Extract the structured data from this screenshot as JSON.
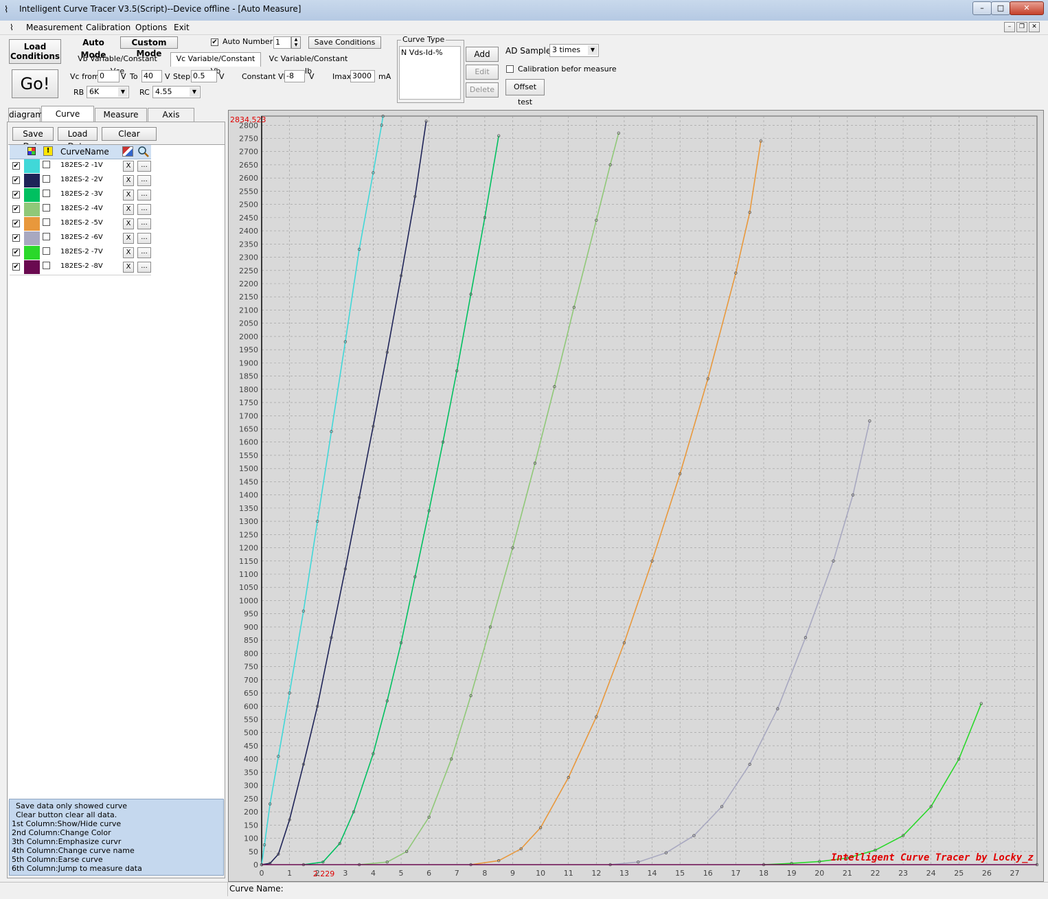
{
  "window": {
    "title": "Intelligent Curve Tracer V3.5(Script)--Device offline - [Auto Measure]",
    "min": "–",
    "max": "□",
    "close": "✕",
    "mdi_min": "–",
    "mdi_restore": "❐",
    "mdi_close": "✕"
  },
  "menu": {
    "items": [
      "Measurement",
      "Calibration",
      "Options",
      "Exit"
    ]
  },
  "toolbar": {
    "load_conditions": "Load Conditions",
    "go": "Go!",
    "auto_mode": "Auto Mode",
    "custom_mode": "Custom Mode",
    "auto_number_label": "Auto Number",
    "auto_number_value": "1",
    "auto_number_checked": "✔",
    "save_conditions": "Save Conditions",
    "mode_tabs": [
      "Vb Variable/Constant Vce",
      "Vc Variable/Constant Vb",
      "Vc Variable/Constant Ib"
    ],
    "vc_from_label": "Vc from",
    "vc_from": "0",
    "v1": "V",
    "to_label": "To",
    "to": "40",
    "v2": "V",
    "step_label": "Step",
    "step": "0.5",
    "v3": "V",
    "constant_vb_label": "Constant Vb",
    "constant_vb": "-8",
    "v4": "V",
    "imax_label": "Imax",
    "imax": "3000",
    "ma": "mA",
    "rb_label": "RB",
    "rb": "6K",
    "rc_label": "RC",
    "rc": "4.55",
    "curve_type_label": "Curve Type",
    "curve_type_item": "N Vds-Id-%",
    "add": "Add",
    "edit": "Edit",
    "delete": "Delete",
    "ad_sample_label": "AD Sample",
    "ad_sample": "3 times",
    "calibration_label": "Calibration befor measure",
    "offset_test": "Offset test"
  },
  "left_tabs": [
    "diagram",
    "Curve Control",
    "Measure Data",
    "Axis Control"
  ],
  "curve_buttons": {
    "save": "Save Data",
    "load": "Load Data",
    "clear": "Clear"
  },
  "grid": {
    "header_name": "CurveName",
    "x_label": "X",
    "jump_label": "...",
    "check": "✔",
    "warn": "!",
    "rows": [
      {
        "name": "182ES-2 -1V",
        "color": "#40d8d8"
      },
      {
        "name": "182ES-2 -2V",
        "color": "#1e2357"
      },
      {
        "name": "182ES-2 -3V",
        "color": "#00c060"
      },
      {
        "name": "182ES-2 -4V",
        "color": "#90c878"
      },
      {
        "name": "182ES-2 -5V",
        "color": "#e8983c"
      },
      {
        "name": "182ES-2 -6V",
        "color": "#a8a8c0"
      },
      {
        "name": "182ES-2 -7V",
        "color": "#2ad82a"
      },
      {
        "name": "182ES-2 -8V",
        "color": "#6a0a50"
      }
    ]
  },
  "help_text": [
    "Save data only showed curve",
    "Clear button clear all data.",
    "1st Column:Show/Hide curve",
    "2nd Column:Change Color",
    "3th Column:Emphasize curvr",
    "4th Column:Change curve name",
    "5th Column:Earse curve",
    "6th Column:Jump to measure data"
  ],
  "status": {
    "curve_name_label": "Curve Name:"
  },
  "chart_data": {
    "type": "line",
    "ylim": [
      0,
      2834.523
    ],
    "xlim": [
      0,
      27.8
    ],
    "x_ticks": [
      0,
      1,
      2,
      3,
      4,
      5,
      6,
      7,
      8,
      9,
      10,
      11,
      12,
      13,
      14,
      15,
      16,
      17,
      18,
      19,
      20,
      21,
      22,
      23,
      24,
      25,
      26,
      27
    ],
    "y_tick_step": 50,
    "y_max_label": "2834.523",
    "x_marker_label": "2.229",
    "x_marker_value": 2.229,
    "watermark": "Intelligent Curve Tracer by Locky_z",
    "grid": true,
    "series": [
      {
        "name": "182ES-2 -1V",
        "color": "#40d8d8",
        "points": [
          [
            0,
            0
          ],
          [
            0.1,
            75
          ],
          [
            0.3,
            230
          ],
          [
            0.6,
            410
          ],
          [
            1.0,
            650
          ],
          [
            1.5,
            960
          ],
          [
            2.0,
            1300
          ],
          [
            2.5,
            1640
          ],
          [
            3.0,
            1980
          ],
          [
            3.5,
            2330
          ],
          [
            4.0,
            2620
          ],
          [
            4.3,
            2800
          ],
          [
            4.35,
            2834
          ]
        ]
      },
      {
        "name": "182ES-2 -2V",
        "color": "#1e2357",
        "points": [
          [
            0,
            0
          ],
          [
            0.3,
            5
          ],
          [
            0.6,
            40
          ],
          [
            1.0,
            170
          ],
          [
            1.5,
            380
          ],
          [
            2.0,
            600
          ],
          [
            2.5,
            860
          ],
          [
            3.0,
            1120
          ],
          [
            3.5,
            1390
          ],
          [
            4.0,
            1660
          ],
          [
            4.5,
            1940
          ],
          [
            5.0,
            2230
          ],
          [
            5.5,
            2530
          ],
          [
            5.9,
            2815
          ]
        ]
      },
      {
        "name": "182ES-2 -3V",
        "color": "#00c060",
        "points": [
          [
            1.5,
            0
          ],
          [
            2.2,
            10
          ],
          [
            2.8,
            80
          ],
          [
            3.3,
            200
          ],
          [
            4.0,
            420
          ],
          [
            4.5,
            620
          ],
          [
            5.0,
            840
          ],
          [
            5.5,
            1090
          ],
          [
            6.0,
            1340
          ],
          [
            6.5,
            1600
          ],
          [
            7.0,
            1870
          ],
          [
            7.5,
            2160
          ],
          [
            8.0,
            2450
          ],
          [
            8.5,
            2760
          ]
        ]
      },
      {
        "name": "182ES-2 -4V",
        "color": "#90c878",
        "points": [
          [
            3.5,
            0
          ],
          [
            4.5,
            10
          ],
          [
            5.2,
            50
          ],
          [
            6.0,
            180
          ],
          [
            6.8,
            400
          ],
          [
            7.5,
            640
          ],
          [
            8.2,
            900
          ],
          [
            9.0,
            1200
          ],
          [
            9.8,
            1520
          ],
          [
            10.5,
            1810
          ],
          [
            11.2,
            2110
          ],
          [
            12.0,
            2440
          ],
          [
            12.5,
            2650
          ],
          [
            12.8,
            2770
          ]
        ]
      },
      {
        "name": "182ES-2 -5V",
        "color": "#e8983c",
        "points": [
          [
            7.5,
            0
          ],
          [
            8.5,
            15
          ],
          [
            9.3,
            60
          ],
          [
            10.0,
            140
          ],
          [
            11.0,
            330
          ],
          [
            12.0,
            560
          ],
          [
            13.0,
            840
          ],
          [
            14.0,
            1150
          ],
          [
            15.0,
            1480
          ],
          [
            16.0,
            1840
          ],
          [
            17.0,
            2240
          ],
          [
            17.5,
            2470
          ],
          [
            17.9,
            2740
          ]
        ]
      },
      {
        "name": "182ES-2 -6V",
        "color": "#a8a8c0",
        "points": [
          [
            12.5,
            0
          ],
          [
            13.5,
            10
          ],
          [
            14.5,
            45
          ],
          [
            15.5,
            110
          ],
          [
            16.5,
            220
          ],
          [
            17.5,
            380
          ],
          [
            18.5,
            590
          ],
          [
            19.5,
            860
          ],
          [
            20.5,
            1150
          ],
          [
            21.2,
            1400
          ],
          [
            21.8,
            1680
          ]
        ]
      },
      {
        "name": "182ES-2 -7V",
        "color": "#2ad82a",
        "points": [
          [
            18.0,
            0
          ],
          [
            19.0,
            5
          ],
          [
            20.0,
            12
          ],
          [
            21.0,
            25
          ],
          [
            22.0,
            55
          ],
          [
            23.0,
            110
          ],
          [
            24.0,
            220
          ],
          [
            25.0,
            400
          ],
          [
            25.8,
            610
          ]
        ]
      },
      {
        "name": "182ES-2 -8V",
        "color": "#6a0a50",
        "points": [
          [
            0,
            0
          ],
          [
            27.8,
            0
          ]
        ]
      }
    ]
  }
}
